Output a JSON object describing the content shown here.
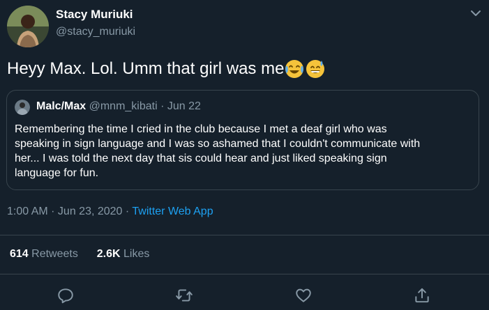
{
  "author": {
    "name": "Stacy Muriuki",
    "handle": "@stacy_muriuki"
  },
  "tweet": {
    "text": "Heyy Max. Lol. Umm that girl was me",
    "emojis": [
      "face-with-tears-of-joy-icon",
      "grinning-face-with-sweat-icon"
    ]
  },
  "quoted": {
    "name": "Malc/Max",
    "handle": "@mnm_kibati",
    "separator": "·",
    "date": "Jun 22",
    "lines": [
      "Remembering the time I cried in the club because I met a deaf girl who was",
      "speaking in sign language and I was so ashamed that I couldn't communicate with",
      "her... I was told the next day that sis could hear and just liked speaking sign",
      "language for fun."
    ]
  },
  "meta": {
    "timestamp": "1:00 AM · Jun 23, 2020",
    "separator": " · ",
    "source": "Twitter Web App"
  },
  "stats": {
    "retweets_count": "614",
    "retweets_label": "Retweets",
    "likes_count": "2.6K",
    "likes_label": "Likes"
  },
  "actions": [
    "reply-icon",
    "retweet-icon",
    "like-icon",
    "share-icon"
  ],
  "colors": {
    "background": "#15202b",
    "text": "#ffffff",
    "secondary_text": "#8899a6",
    "accent": "#1da1f2",
    "border": "#38444d"
  }
}
